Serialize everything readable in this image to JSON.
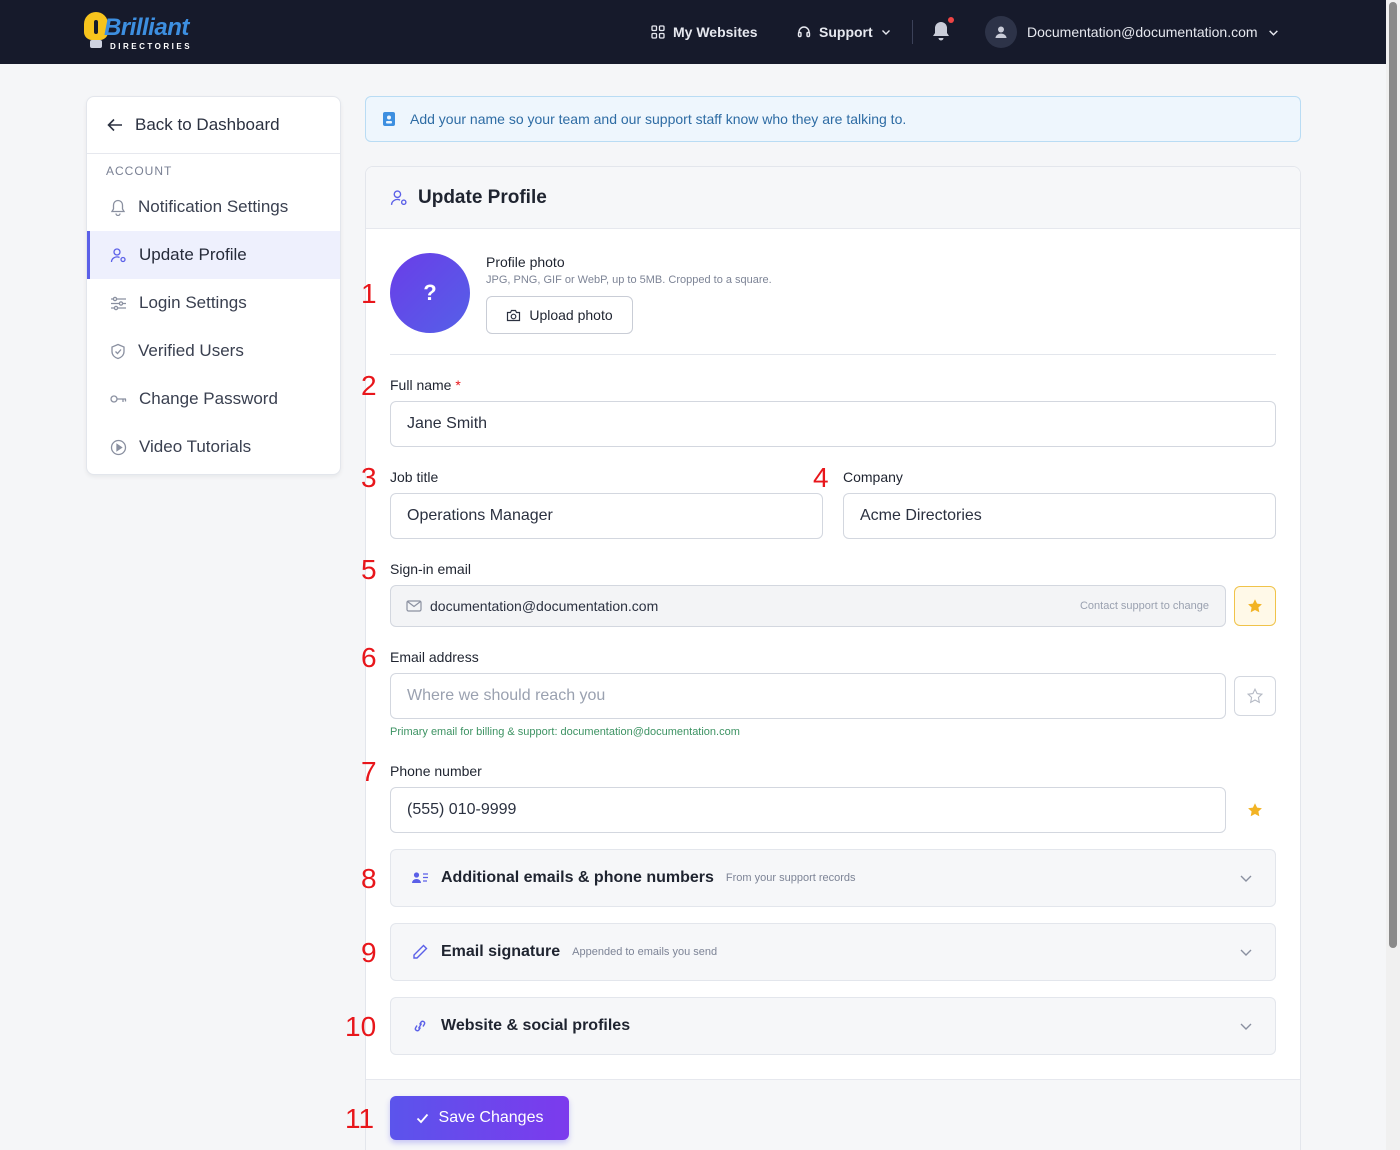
{
  "brand": {
    "name": "Brilliant",
    "tagline": "DIRECTORIES"
  },
  "topnav": {
    "my_websites": "My Websites",
    "support": "Support",
    "user_email": "Documentation@documentation.com"
  },
  "sidebar": {
    "back": "Back to Dashboard",
    "section": "ACCOUNT",
    "items": [
      {
        "label": "Notification Settings",
        "icon": "bell-icon"
      },
      {
        "label": "Update Profile",
        "icon": "user-gear-icon",
        "active": true
      },
      {
        "label": "Login Settings",
        "icon": "sliders-icon"
      },
      {
        "label": "Verified Users",
        "icon": "shield-check-icon"
      },
      {
        "label": "Change Password",
        "icon": "key-icon"
      },
      {
        "label": "Video Tutorials",
        "icon": "play-circle-icon"
      }
    ]
  },
  "banner": {
    "text": "Add your name so your team and our support staff know who they are talking to."
  },
  "card": {
    "title": "Update Profile",
    "photo": {
      "placeholder_glyph": "?",
      "title": "Profile photo",
      "hint": "JPG, PNG, GIF or WebP, up to 5MB. Cropped to a square.",
      "upload_label": "Upload photo"
    },
    "fields": {
      "full_name": {
        "label": "Full name",
        "required_mark": "*",
        "value": "Jane Smith"
      },
      "job_title": {
        "label": "Job title",
        "value": "Operations Manager"
      },
      "company": {
        "label": "Company",
        "value": "Acme Directories"
      },
      "signin_email": {
        "label": "Sign-in email",
        "value": "documentation@documentation.com",
        "note": "Contact support to change",
        "starred": true
      },
      "email_address": {
        "label": "Email address",
        "placeholder": "Where we should reach you",
        "helper": "Primary email for billing & support: documentation@documentation.com",
        "starred": false
      },
      "phone": {
        "label": "Phone number",
        "value": "(555) 010-9999",
        "starred": true
      }
    },
    "accordions": [
      {
        "title": "Additional emails & phone numbers",
        "subtitle": "From your support records",
        "icon": "contact-list-icon"
      },
      {
        "title": "Email signature",
        "subtitle": "Appended to emails you send",
        "icon": "pen-icon"
      },
      {
        "title": "Website & social profiles",
        "subtitle": "",
        "icon": "link-icon"
      }
    ],
    "save_label": "Save Changes"
  },
  "annotations": [
    "1",
    "2",
    "3",
    "4",
    "5",
    "6",
    "7",
    "8",
    "9",
    "10",
    "11"
  ],
  "colors": {
    "accent": "#5b60e8",
    "star": "#f2b324",
    "annotation": "#e8161b",
    "topbar": "#161a2b"
  }
}
